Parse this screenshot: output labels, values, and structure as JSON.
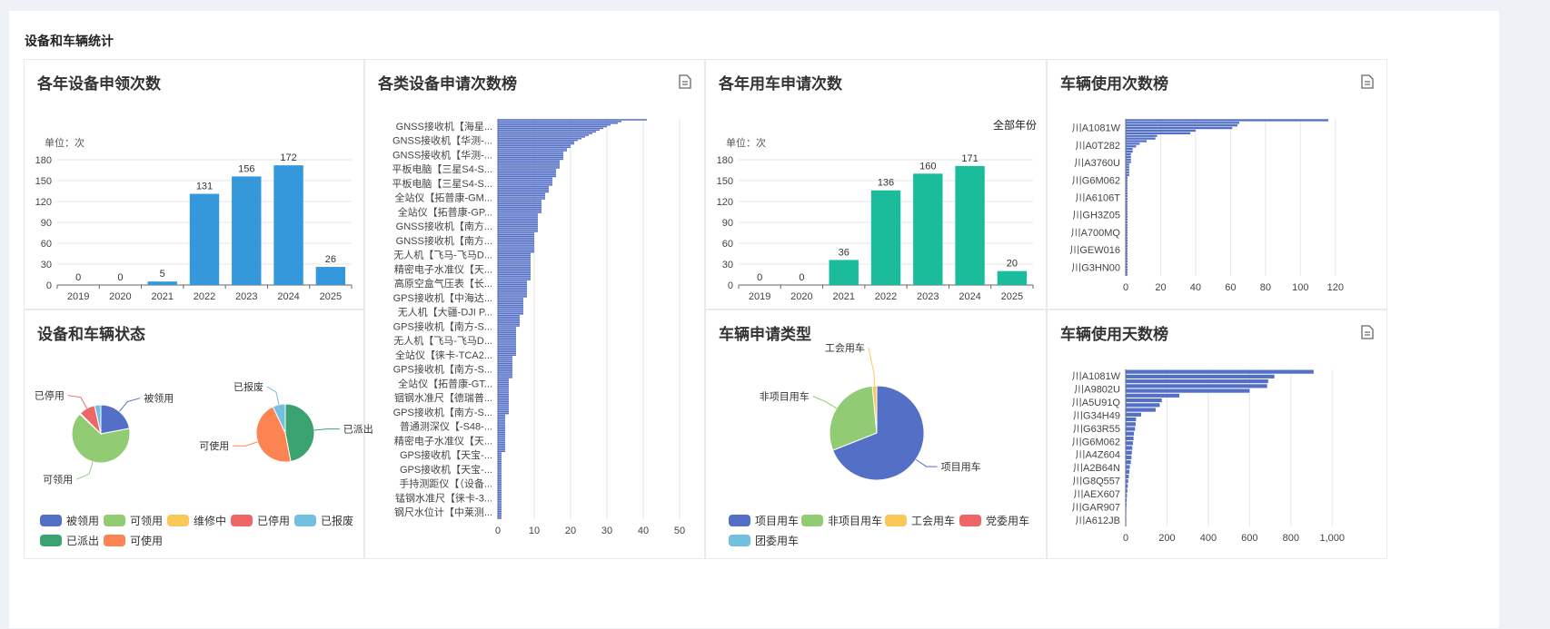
{
  "card_title": "设备和车辆统计",
  "colors": {
    "blue": "#3498db",
    "green": "#1abc9c",
    "bar": "#5470c6",
    "pie": [
      "#5470c6",
      "#91cc75",
      "#fac858",
      "#ee6666",
      "#73c0de",
      "#3ba272",
      "#fc8452"
    ]
  },
  "panels": {
    "device_yearly": {
      "title": "各年设备申领次数"
    },
    "device_rank": {
      "title": "各类设备申请次数榜",
      "export_icon": "document-icon"
    },
    "vehicle_yearly": {
      "title": "各年用车申请次数",
      "filter_label": "全部年份"
    },
    "vehicle_count_rank": {
      "title": "车辆使用次数榜",
      "export_icon": "document-icon"
    },
    "status": {
      "title": "设备和车辆状态"
    },
    "vehicle_type": {
      "title": "车辆申请类型"
    },
    "vehicle_days_rank": {
      "title": "车辆使用天数榜",
      "export_icon": "document-icon"
    }
  },
  "chart_data": [
    {
      "id": "device_yearly",
      "type": "bar",
      "unit": "单位：次",
      "categories": [
        "2019",
        "2020",
        "2021",
        "2022",
        "2023",
        "2024",
        "2025"
      ],
      "values": [
        0,
        0,
        5,
        131,
        156,
        172,
        26
      ],
      "ylim": [
        0,
        180
      ],
      "yticks": [
        0,
        30,
        60,
        90,
        120,
        150,
        180
      ],
      "color": "#3498db"
    },
    {
      "id": "vehicle_yearly",
      "type": "bar",
      "unit": "单位：次",
      "categories": [
        "2019",
        "2020",
        "2021",
        "2022",
        "2023",
        "2024",
        "2025"
      ],
      "values": [
        0,
        0,
        36,
        136,
        160,
        171,
        20
      ],
      "ylim": [
        0,
        180
      ],
      "yticks": [
        0,
        30,
        60,
        90,
        120,
        150,
        180
      ],
      "color": "#1abc9c"
    },
    {
      "id": "device_rank",
      "type": "bar",
      "orientation": "horizontal",
      "xlim": [
        0,
        50
      ],
      "xticks": [
        0,
        10,
        20,
        30,
        40,
        50
      ],
      "labels": [
        "GNSS接收机【海星...",
        "GNSS接收机【华测-...",
        "GNSS接收机【华测-...",
        "平板电脑【三星S4-S...",
        "平板电脑【三星S4-S...",
        "全站仪【拓普康-GM...",
        "全站仪【拓普康-GP...",
        "GNSS接收机【南方...",
        "GNSS接收机【南方...",
        "无人机【飞马-飞马D...",
        "精密电子水准仪【天...",
        "高原空盒气压表【长...",
        "GPS接收机【中海达...",
        "无人机【大疆-DJI P...",
        "GPS接收机【南方-S...",
        "无人机【飞马-飞马D...",
        "全站仪【徕卡-TCA2...",
        "GPS接收机【南方-S...",
        "全站仪【拓普康-GT...",
        "铟钢水准尺【德瑞普...",
        "GPS接收机【南方-S...",
        "普通测深仪【-S48-...",
        "精密电子水准仪【天...",
        "GPS接收机【天宝-...",
        "GPS接收机【天宝-...",
        "手持测距仪【（设备...",
        "锰钢水准尺【徕卡-3...",
        "钢尺水位计【中莱测..."
      ],
      "values": [
        41,
        34,
        33,
        31,
        30,
        29,
        28,
        27,
        26,
        25,
        24,
        23,
        22,
        21,
        21,
        20,
        20,
        19,
        19,
        18,
        18,
        18,
        18,
        18,
        17,
        17,
        17,
        17,
        17,
        16,
        16,
        16,
        16,
        16,
        15,
        15,
        15,
        15,
        15,
        14,
        14,
        14,
        14,
        13,
        13,
        13,
        13,
        12,
        12,
        12,
        12,
        12,
        12,
        12,
        12,
        11,
        11,
        11,
        11,
        11,
        11,
        11,
        11,
        11,
        11,
        11,
        10,
        10,
        10,
        10,
        10,
        10,
        10,
        10,
        10,
        10,
        10,
        10,
        9,
        9,
        9,
        9,
        9,
        9,
        9,
        9,
        9,
        9,
        9,
        9,
        9,
        9,
        9,
        9,
        8,
        8,
        8,
        8,
        8,
        8,
        8,
        8,
        8,
        8,
        7,
        7,
        7,
        7,
        7,
        7,
        7,
        7,
        7,
        7,
        6,
        6,
        6,
        6,
        6,
        6,
        6,
        5,
        5,
        5,
        5,
        5,
        5,
        5,
        5,
        5,
        5,
        5,
        5,
        5,
        5,
        5,
        5,
        5,
        4,
        4,
        4,
        4,
        4,
        4,
        4,
        4,
        4,
        4,
        4,
        4,
        4,
        3,
        3,
        3,
        3,
        3,
        3,
        3,
        3,
        3,
        3,
        3,
        3,
        3,
        3,
        3,
        3,
        3,
        3,
        3,
        3,
        3,
        2,
        2,
        2,
        2,
        2,
        2,
        2,
        2,
        2,
        2,
        2,
        2,
        2,
        2,
        2,
        2,
        2,
        2,
        2,
        2,
        2,
        2,
        1,
        1,
        1,
        1,
        1,
        1,
        1,
        1,
        1,
        1,
        1,
        1,
        1,
        1,
        1,
        1,
        1,
        1,
        1,
        1,
        1,
        1,
        1,
        1,
        1,
        1,
        1,
        1,
        1,
        1,
        1,
        1,
        1,
        1,
        1,
        1,
        1,
        1,
        1
      ]
    },
    {
      "id": "vehicle_count_rank",
      "type": "bar",
      "orientation": "horizontal",
      "xlim": [
        0,
        130
      ],
      "xticks": [
        0,
        20,
        40,
        60,
        80,
        100,
        120
      ],
      "labels": [
        "川A1081W",
        "川A0T282",
        "川A3760U",
        "川G6M062",
        "川A6106T",
        "川GH3Z05",
        "川A700MQ",
        "川GEW016",
        "川G3HN00"
      ],
      "values": [
        116,
        65,
        64,
        61,
        40,
        37,
        18,
        17,
        12,
        8,
        6,
        4,
        4,
        3,
        3,
        3,
        3,
        2,
        2,
        2,
        2,
        2,
        1,
        1,
        1,
        1,
        1,
        1,
        1,
        1,
        1,
        1,
        1,
        1,
        1,
        1,
        1,
        1,
        1,
        1,
        1,
        1,
        1,
        1,
        1,
        1,
        1,
        1,
        1,
        1,
        1,
        1,
        1,
        1,
        1,
        1,
        1,
        1,
        1,
        1
      ]
    },
    {
      "id": "vehicle_days_rank",
      "type": "bar",
      "orientation": "horizontal",
      "xlim": [
        0,
        1100
      ],
      "xticks": [
        0,
        200,
        400,
        600,
        800,
        1000
      ],
      "xtick_labels": [
        "0",
        "200",
        "400",
        "600",
        "800",
        "1,000"
      ],
      "labels": [
        "川A1081W",
        "川A9802U",
        "川A5U91Q",
        "川G34H49",
        "川G63R55",
        "川G6M062",
        "川A4Z604",
        "川A2B64N",
        "川G8Q557",
        "川AEX607",
        "川GAR907",
        "川A612JB"
      ],
      "values": [
        910,
        720,
        690,
        685,
        600,
        260,
        175,
        165,
        145,
        75,
        50,
        48,
        45,
        40,
        38,
        35,
        32,
        30,
        28,
        25,
        20,
        18,
        15,
        12,
        10,
        8,
        6,
        5,
        4,
        3,
        2,
        2,
        1
      ]
    },
    {
      "id": "status_equipment",
      "type": "pie",
      "slices": [
        {
          "name": "被领用",
          "value": 22
        },
        {
          "name": "可领用",
          "value": 65
        },
        {
          "name": "维修中",
          "value": 0.5
        },
        {
          "name": "已停用",
          "value": 9
        },
        {
          "name": "已报废",
          "value": 3.5
        }
      ],
      "colors": [
        "#5470c6",
        "#91cc75",
        "#fac858",
        "#ee6666",
        "#73c0de"
      ]
    },
    {
      "id": "status_vehicle",
      "type": "pie",
      "slices": [
        {
          "name": "已派出",
          "value": 47
        },
        {
          "name": "可使用",
          "value": 46
        },
        {
          "name": "已报废",
          "value": 7
        }
      ],
      "colors": [
        "#3ba272",
        "#fc8452",
        "#73c0de"
      ]
    },
    {
      "id": "vehicle_type",
      "type": "pie",
      "slices": [
        {
          "name": "项目用车",
          "value": 69
        },
        {
          "name": "非项目用车",
          "value": 29.5
        },
        {
          "name": "工会用车",
          "value": 1.5
        }
      ],
      "colors": [
        "#5470c6",
        "#91cc75",
        "#fac858"
      ],
      "legend": [
        "项目用车",
        "非项目用车",
        "工会用车",
        "党委用车",
        "团委用车"
      ],
      "legend_colors": [
        "#5470c6",
        "#91cc75",
        "#fac858",
        "#ee6666",
        "#73c0de"
      ]
    }
  ],
  "status_legend": {
    "labels": [
      "被领用",
      "可领用",
      "维修中",
      "已停用",
      "已报废",
      "已派出",
      "可使用"
    ],
    "colors": [
      "#5470c6",
      "#91cc75",
      "#fac858",
      "#ee6666",
      "#73c0de",
      "#3ba272",
      "#fc8452"
    ]
  }
}
